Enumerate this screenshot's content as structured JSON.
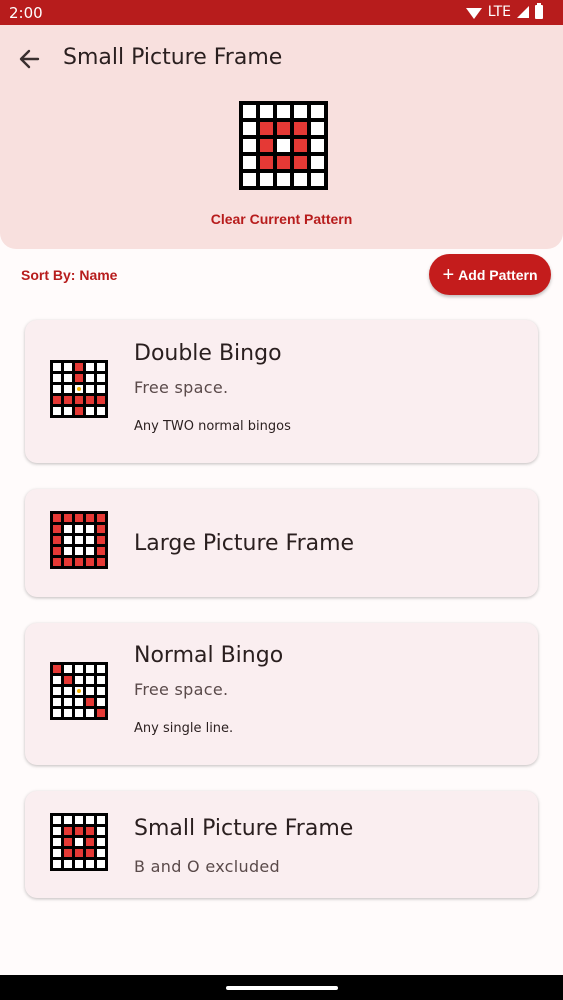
{
  "status": {
    "time": "2:00",
    "network": "LTE"
  },
  "header": {
    "title": "Small Picture Frame",
    "clear_label": "Clear Current Pattern",
    "pattern": [
      [
        0,
        0,
        0,
        0,
        0
      ],
      [
        0,
        1,
        1,
        1,
        0
      ],
      [
        0,
        1,
        0,
        1,
        0
      ],
      [
        0,
        1,
        1,
        1,
        0
      ],
      [
        0,
        0,
        0,
        0,
        0
      ]
    ]
  },
  "toolbar": {
    "sort_label": "Sort By: Name",
    "add_label": "Add Pattern"
  },
  "colors": {
    "accent": "#b71c1c",
    "marked": "#e53935",
    "free_space": "#f4b400",
    "card_bg": "#faeef0",
    "header_bg": "#f8e0de"
  },
  "cards": [
    {
      "title": "Double Bingo",
      "subtitle": "Free space.",
      "description": "Any TWO normal bingos",
      "pattern": [
        [
          0,
          0,
          1,
          0,
          0
        ],
        [
          0,
          0,
          1,
          0,
          0
        ],
        [
          0,
          0,
          2,
          0,
          0
        ],
        [
          1,
          1,
          1,
          1,
          1
        ],
        [
          0,
          0,
          1,
          0,
          0
        ]
      ]
    },
    {
      "title": "Large Picture Frame",
      "subtitle": "",
      "description": "",
      "pattern": [
        [
          1,
          1,
          1,
          1,
          1
        ],
        [
          1,
          0,
          0,
          0,
          1
        ],
        [
          1,
          0,
          0,
          0,
          1
        ],
        [
          1,
          0,
          0,
          0,
          1
        ],
        [
          1,
          1,
          1,
          1,
          1
        ]
      ]
    },
    {
      "title": "Normal Bingo",
      "subtitle": "Free space.",
      "description": "Any single line.",
      "pattern": [
        [
          1,
          0,
          0,
          0,
          0
        ],
        [
          0,
          1,
          0,
          0,
          0
        ],
        [
          0,
          0,
          2,
          0,
          0
        ],
        [
          0,
          0,
          0,
          1,
          0
        ],
        [
          0,
          0,
          0,
          0,
          1
        ]
      ]
    },
    {
      "title": "Small Picture Frame",
      "subtitle": "B and O excluded",
      "description": "",
      "pattern": [
        [
          0,
          0,
          0,
          0,
          0
        ],
        [
          0,
          1,
          1,
          1,
          0
        ],
        [
          0,
          1,
          0,
          1,
          0
        ],
        [
          0,
          1,
          1,
          1,
          0
        ],
        [
          0,
          0,
          0,
          0,
          0
        ]
      ]
    }
  ]
}
